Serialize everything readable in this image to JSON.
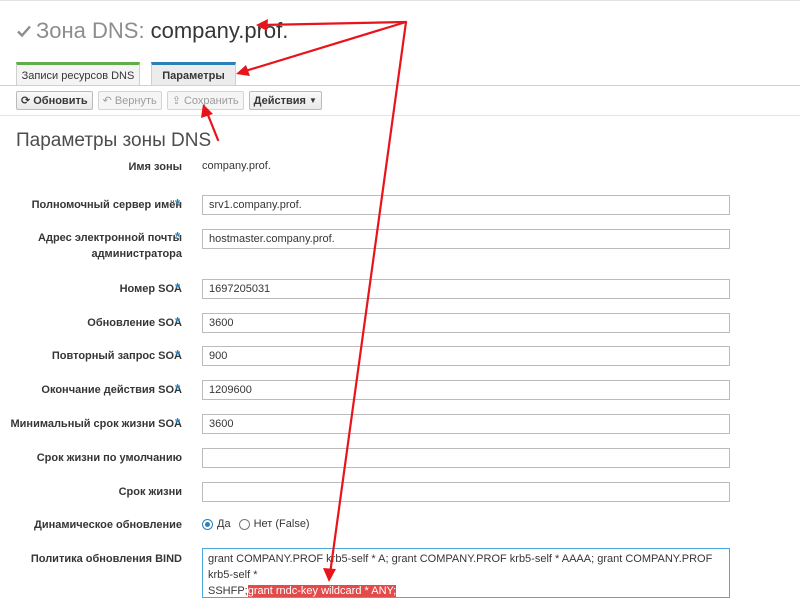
{
  "header": {
    "title_prefix": "Зона DNS:",
    "zone_name": "company.prof."
  },
  "tabs": [
    {
      "label": "Записи ресурсов DNS"
    },
    {
      "label": "Параметры"
    }
  ],
  "toolbar": {
    "refresh": "Обновить",
    "revert": "Вернуть",
    "save": "Сохранить",
    "actions": "Действия"
  },
  "section_title": "Параметры зоны DNS",
  "fields": {
    "zone_name": {
      "label": "Имя зоны",
      "value": "company.prof."
    },
    "authoritative_ns": {
      "label": "Полномочный сервер имён",
      "value": "srv1.company.prof."
    },
    "admin_email": {
      "label_line1": "Адрес электронной почты",
      "label_line2": "администратора",
      "value": "hostmaster.company.prof."
    },
    "soa_serial": {
      "label": "Номер SOA",
      "value": "1697205031"
    },
    "soa_refresh": {
      "label": "Обновление SOA",
      "value": "3600"
    },
    "soa_retry": {
      "label": "Повторный запрос SOA",
      "value": "900"
    },
    "soa_expire": {
      "label": "Окончание действия SOA",
      "value": "1209600"
    },
    "soa_minimum": {
      "label": "Минимальный срок жизни SOA",
      "value": "3600"
    },
    "default_ttl": {
      "label": "Срок жизни по умолчанию",
      "value": ""
    },
    "ttl": {
      "label": "Срок жизни",
      "value": ""
    },
    "dynamic_update": {
      "label": "Динамическое обновление",
      "option_yes": "Да",
      "option_no": "Нет (False)"
    },
    "bind_policy": {
      "label": "Политика обновления BIND",
      "line1": "grant COMPANY.PROF krb5-self * A; grant COMPANY.PROF krb5-self * AAAA; grant COMPANY.PROF krb5-self *",
      "line2_plain": "SSHFP;",
      "line2_highlight": "grant rndc-key wildcard * ANY;"
    }
  },
  "required_marker": "*",
  "colors": {
    "accent_blue": "#2d7fb8",
    "tab_green": "#5fae4b",
    "annotation_red": "#e8141b",
    "highlight": "#e34a4a"
  }
}
